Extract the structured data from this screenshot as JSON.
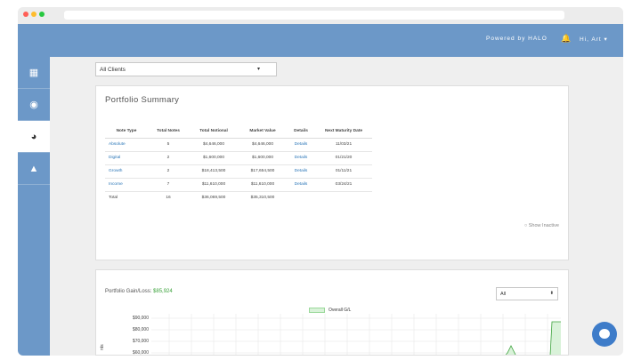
{
  "header": {
    "powered_by": "Powered by HALO",
    "greeting": "Hi, Art",
    "greeting_caret": "▾",
    "bell_icon": "bell-icon"
  },
  "sidebar": {
    "items": [
      {
        "icon": "calendar-icon",
        "glyph": "▦"
      },
      {
        "icon": "eye-icon",
        "glyph": "◉"
      },
      {
        "icon": "pie-chart-icon",
        "glyph": "◕",
        "active": true
      },
      {
        "icon": "graduation-cap-icon",
        "glyph": "▲"
      }
    ]
  },
  "client_select": {
    "value": "All Clients",
    "caret": "▾"
  },
  "portfolio_summary": {
    "title": "Portfolio Summary",
    "columns": [
      "Note Type",
      "Total Notes",
      "Total Notional",
      "Market Value",
      "Details",
      "Next Maturity Date"
    ],
    "rows": [
      {
        "type": "Absolute",
        "notes": "5",
        "notional": "$4,646,000",
        "market": "$4,646,000",
        "details": "Details",
        "maturity": "11/03/21"
      },
      {
        "type": "Digital",
        "notes": "2",
        "notional": "$1,600,000",
        "market": "$1,600,000",
        "details": "Details",
        "maturity": "01/21/20"
      },
      {
        "type": "Growth",
        "notes": "2",
        "notional": "$18,413,500",
        "market": "$17,654,500",
        "details": "Details",
        "maturity": "01/11/21"
      },
      {
        "type": "Income",
        "notes": "7",
        "notional": "$11,610,000",
        "market": "$11,610,000",
        "details": "Details",
        "maturity": "03/24/21"
      }
    ],
    "total": {
      "label": "Total",
      "notes": "16",
      "notional": "$36,069,500",
      "market": "$35,310,500"
    },
    "show_inactive": "Show Inactive"
  },
  "gain_loss": {
    "label": "Portfolio Gain/Loss:",
    "value": "$85,924",
    "select_value": "All",
    "select_arrows": "⬍",
    "chart_data": {
      "type": "line",
      "legend": [
        "Overall G/L"
      ],
      "yticks": [
        "$90,000",
        "$80,000",
        "$70,000",
        "$60,000"
      ],
      "ylabel": "nts",
      "line_color": "#3ba23b",
      "fill_color": "#d9f2d9"
    }
  },
  "chat_icon": "chat-bubble-icon"
}
